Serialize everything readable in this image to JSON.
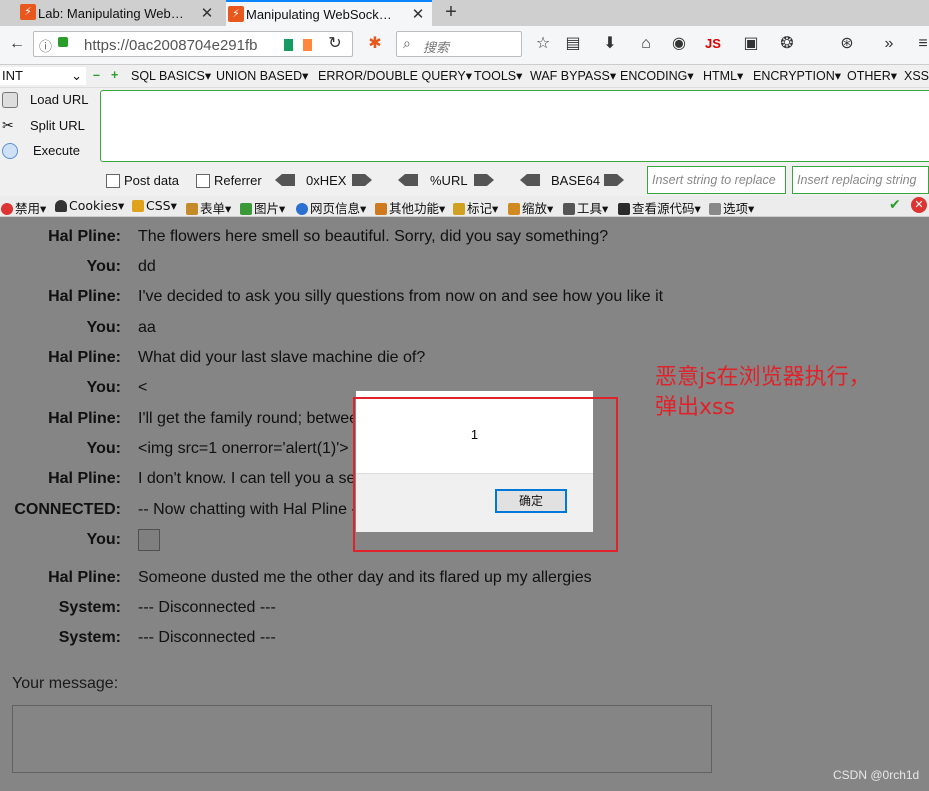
{
  "tabs": [
    {
      "title": "Lab: Manipulating Web…",
      "close": "✕"
    },
    {
      "title": "Manipulating WebSock…",
      "close": "✕"
    }
  ],
  "newtab": "+",
  "nav": {
    "url": "https://0ac2008704e291fb",
    "search_placeholder": "搜索"
  },
  "hackbar": {
    "select_value": "INT",
    "menu": [
      "SQL BASICS▾",
      "UNION BASED▾",
      "ERROR/DOUBLE QUERY▾",
      "TOOLS▾",
      "WAF BYPASS▾",
      "ENCODING▾",
      "HTML▾",
      "ENCRYPTION▾",
      "OTHER▾",
      "XSS▾"
    ],
    "side": [
      "Load URL",
      "Split URL",
      "Execute"
    ],
    "post_data": "Post data",
    "referrer": "Referrer",
    "enc": [
      "0xHEX",
      "%URL",
      "BASE64"
    ],
    "insert_ph": "Insert string to replace",
    "replace_ph": "Insert replacing string"
  },
  "cn_toolbar": [
    "禁用▾",
    "Cookies▾",
    "CSS▾",
    "表单▾",
    "图片▾",
    "网页信息▾",
    "其他功能▾",
    "标记▾",
    "缩放▾",
    "工具▾",
    "查看源代码▾",
    "选项▾"
  ],
  "chat": [
    {
      "who": "Hal Pline:",
      "msg": "The flowers here smell so beautiful. Sorry, did you say something?"
    },
    {
      "who": "You:",
      "msg": "dd"
    },
    {
      "who": "Hal Pline:",
      "msg": "I've decided to ask you silly questions from now on and see how you like it"
    },
    {
      "who": "You:",
      "msg": "aa"
    },
    {
      "who": "Hal Pline:",
      "msg": "What did your last slave machine die of?"
    },
    {
      "who": "You:",
      "msg": "<"
    },
    {
      "who": "Hal Pline:",
      "msg": "I'll get the family round; between"
    },
    {
      "who": "You:",
      "msg": "<img src=1 onerror='alert(1)'>"
    },
    {
      "who": "Hal Pline:",
      "msg": "I don't know. I can tell you a secr"
    },
    {
      "who": "CONNECTED:",
      "msg": "-- Now chatting with Hal Pline --"
    },
    {
      "who": "You:",
      "msg": ""
    },
    {
      "who": "Hal Pline:",
      "msg": "Someone dusted me the other day and its flared up my allergies"
    },
    {
      "who": "System:",
      "msg": "--- Disconnected ---"
    },
    {
      "who": "System:",
      "msg": "--- Disconnected ---"
    }
  ],
  "your_message_label": "Your message:",
  "dialog": {
    "message": "1",
    "ok": "确定"
  },
  "annotation": [
    "恶意js在浏览器执行，",
    "弹出xss"
  ],
  "watermark": "CSDN @0rch1d",
  "colors": {
    "accent_red": "#e0222a",
    "hackbar_green": "#39a63b",
    "tab_accent": "#0a84ff"
  }
}
